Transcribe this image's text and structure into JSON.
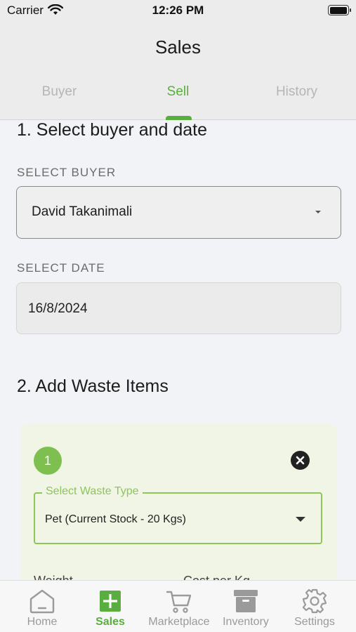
{
  "status_bar": {
    "carrier": "Carrier",
    "time": "12:26 PM"
  },
  "header": {
    "title": "Sales",
    "tabs": [
      {
        "label": "Buyer",
        "active": false
      },
      {
        "label": "Sell",
        "active": true
      },
      {
        "label": "History",
        "active": false
      }
    ]
  },
  "section1": {
    "title": "1. Select buyer and date",
    "buyer_label": "SELECT BUYER",
    "buyer_value": "David Takanimali",
    "date_label": "SELECT DATE",
    "date_value": "16/8/2024"
  },
  "section2": {
    "title": "2. Add Waste Items",
    "item": {
      "number": "1",
      "waste_type_label": "Select Waste Type",
      "waste_type_value": "Pet  (Current Stock - 20 Kgs)",
      "weight_label": "Weight",
      "cost_label": "Cost per Kg"
    }
  },
  "bottom_nav": [
    {
      "label": "Home",
      "icon": "home-icon"
    },
    {
      "label": "Sales",
      "icon": "plus-square-icon",
      "active": true
    },
    {
      "label": "Marketplace",
      "icon": "cart-icon"
    },
    {
      "label": "Inventory",
      "icon": "archive-box-icon"
    },
    {
      "label": "Settings",
      "icon": "gear-icon"
    }
  ],
  "colors": {
    "accent": "#5aae3f",
    "badge": "#7dc04f",
    "card": "#f1f5e6",
    "outline": "#8cc55a"
  }
}
